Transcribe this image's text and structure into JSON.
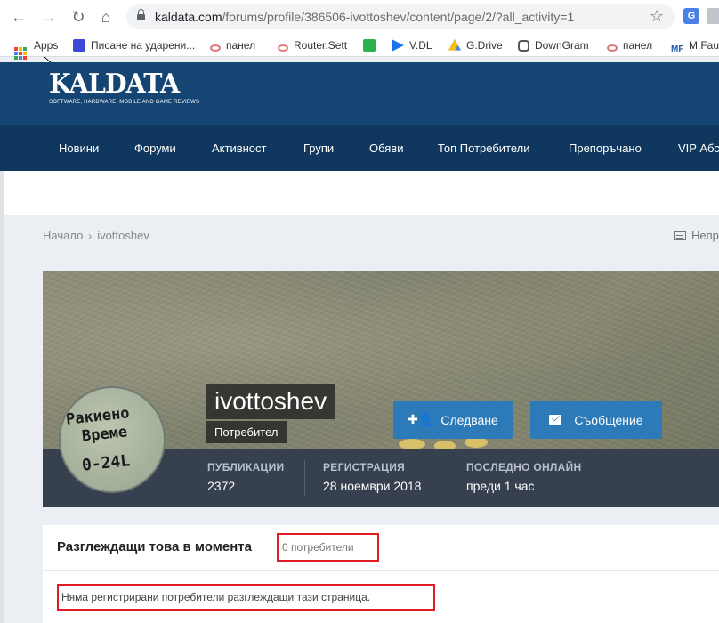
{
  "browser": {
    "url_host": "kaldata.com",
    "url_path": "/forums/profile/386506-ivottoshev/content/page/2/?all_activity=1",
    "bookmarks": [
      "Apps",
      "Писане на ударени...",
      "панел",
      "Router.Sett",
      "V.DL",
      "G.Drive",
      "DownGram",
      "панел",
      "M.Fau"
    ]
  },
  "site": {
    "logo": "KALDATA",
    "tagline": "SOFTWARE, HARDWARE, MOBILE AND GAME REVIEWS",
    "nav": [
      "Новини",
      "Форуми",
      "Активност",
      "Групи",
      "Обяви",
      "Топ Потребители",
      "Препоръчано",
      "VIP Абс"
    ]
  },
  "breadcrumb": {
    "home": "Начало",
    "current": "ivottoshev",
    "unread": "Непр"
  },
  "profile": {
    "username": "ivottoshev",
    "role": "Потребител",
    "follow_label": "Следване",
    "message_label": "Съобщение",
    "avatar_lines": [
      "Ракиено",
      "Време",
      "0-24L"
    ],
    "stats": [
      {
        "label": "ПУБЛИКАЦИИ",
        "value": "2372"
      },
      {
        "label": "РЕГИСТРАЦИЯ",
        "value": "28 ноември 2018"
      },
      {
        "label": "ПОСЛЕДНО ОНЛАЙН",
        "value": "преди 1 час"
      }
    ]
  },
  "viewers": {
    "title": "Разглеждащи това в момента",
    "count": "0 потребители",
    "empty": "Няма регистрирани потребители разглеждащи тази страница."
  },
  "colors": {
    "header": "#154572",
    "nav": "#10385e",
    "button": "#2c7ab7",
    "stats_bar": "#36404e",
    "highlight": "#e01b24"
  }
}
